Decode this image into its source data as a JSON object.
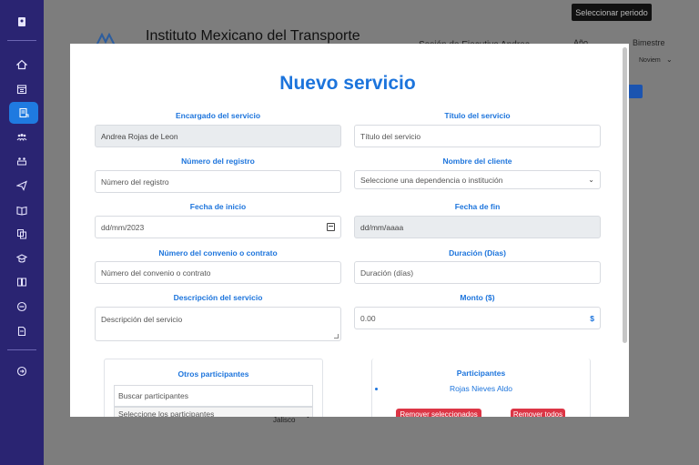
{
  "background": {
    "period_button": "Seleccionar periodo",
    "institute_title": "Instituto Mexicano del Transporte",
    "session_text": "Sesión de Ejecutivo Andrea",
    "year_label": "Año",
    "bimester_label": "Bimestre",
    "bimester_value": "Noviem",
    "state_value": "Jalisco"
  },
  "modal": {
    "title": "Nuevo servicio",
    "fields": {
      "manager": {
        "label": "Encargado del servicio",
        "value": "Andrea Rojas de Leon"
      },
      "service_title": {
        "label": "Título del servicio",
        "placeholder": "Título del servicio"
      },
      "registry_number": {
        "label": "Número del registro",
        "placeholder": "Número del registro"
      },
      "client_name": {
        "label": "Nombre del cliente",
        "value": "Seleccione una dependencia o institución"
      },
      "start_date": {
        "label": "Fecha de inicio",
        "value": "dd/mm/2023"
      },
      "end_date": {
        "label": "Fecha de fin",
        "value": "dd/mm/aaaa"
      },
      "agreement_number": {
        "label": "Número del convenio o contrato",
        "placeholder": "Número del convenio o contrato"
      },
      "duration": {
        "label": "Duración (Días)",
        "placeholder": "Duración (días)"
      },
      "description": {
        "label": "Descripción del servicio",
        "placeholder": "Descripción del servicio"
      },
      "amount": {
        "label": "Monto ($)",
        "value": "0.00",
        "currency_symbol": "$"
      }
    },
    "other_participants": {
      "title": "Otros participantes",
      "search_placeholder": "Buscar participantes",
      "select_placeholder": "Seleccione los participantes"
    },
    "participants": {
      "title": "Participantes",
      "items": [
        "Rojas Nieves Aldo"
      ],
      "remove_selected_button": "Remover seleccionados",
      "remove_all_button": "Remover todos"
    }
  },
  "colors": {
    "sidebar": "#2a2472",
    "accent": "#1c74dc",
    "danger": "#dc3545"
  }
}
